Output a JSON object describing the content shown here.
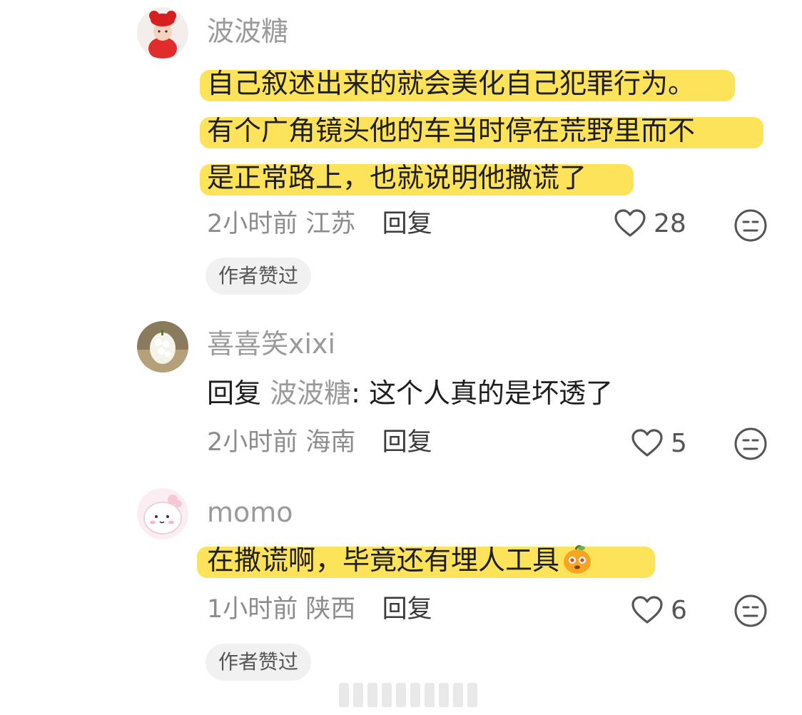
{
  "comments": [
    {
      "username": "波波糖",
      "lines": [
        "自己叙述出来的就会美化自己犯罪行为。",
        "有个广角镜头他的车当时停在荒野里而不",
        "是正常路上，也就说明他撒谎了"
      ],
      "time": "2小时前",
      "location": "江苏",
      "reply_label": "回复",
      "likes": "28",
      "badge": "作者赞过"
    },
    {
      "username": "喜喜笑xixi",
      "reply_prefix": "回复",
      "reply_target": "波波糖",
      "text": ": 这个人真的是坏透了",
      "time": "2小时前",
      "location": "海南",
      "reply_label": "回复",
      "likes": "5"
    },
    {
      "username": "momo",
      "text": "在撒谎啊，毕竟还有埋人工具",
      "time": "1小时前",
      "location": "陕西",
      "reply_label": "回复",
      "likes": "6",
      "badge": "作者赞过"
    }
  ],
  "colors": {
    "highlight": "#fde047",
    "username": "#9a9a9a",
    "meta": "#8c8c8c",
    "badge_bg": "#f1f1f1"
  },
  "icons": [
    "heart-outline-icon",
    "neutral-face-icon",
    "orange-emoji-icon"
  ]
}
